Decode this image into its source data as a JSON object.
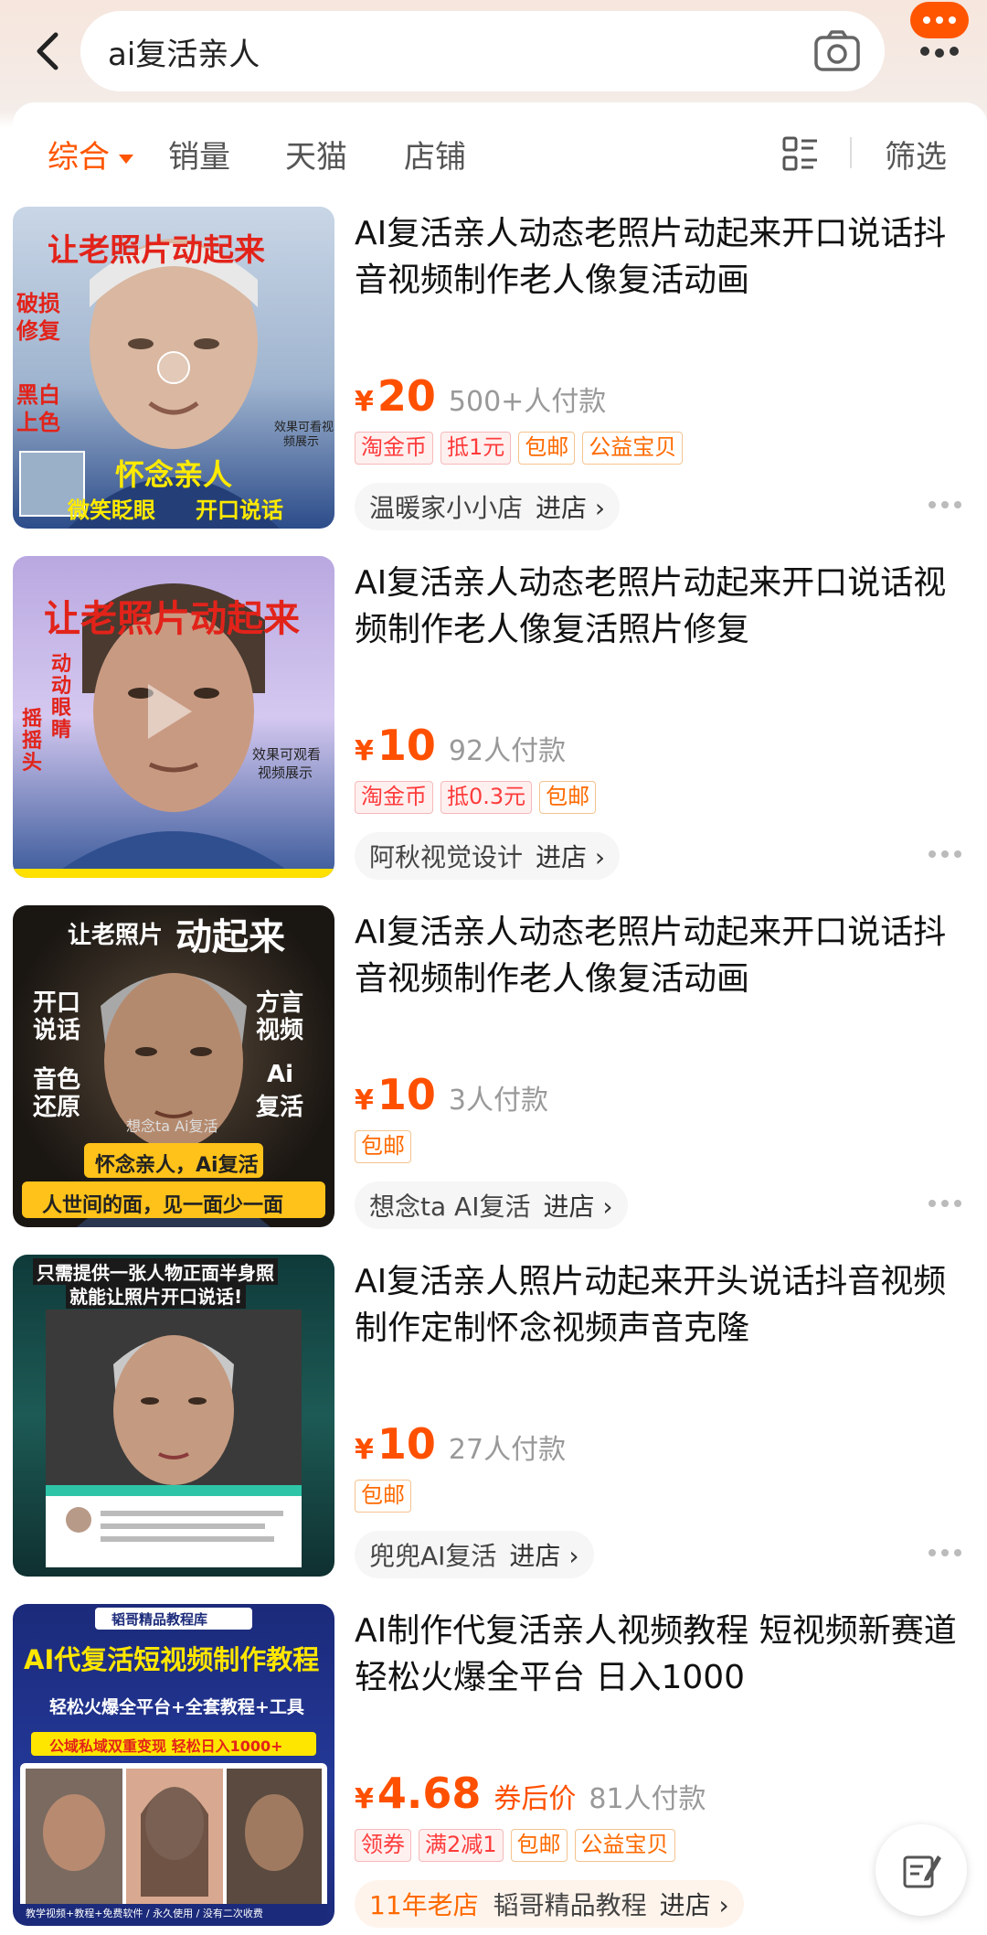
{
  "search": {
    "query": "ai复活亲人"
  },
  "filters": {
    "tabs": [
      {
        "label": "综合"
      },
      {
        "label": "销量"
      },
      {
        "label": "天猫"
      },
      {
        "label": "店铺"
      }
    ],
    "filter_label": "筛选"
  },
  "colors": {
    "accent": "#ff5500",
    "price": "#ff5000"
  },
  "items": [
    {
      "title": "AI复活亲人动态老照片动起来开口说话抖音视频制作老人像复活动画",
      "currency": "¥",
      "price": "20",
      "paid": "500+人付款",
      "tags": [
        "淘金币",
        "抵1元",
        "包邮",
        "公益宝贝"
      ],
      "shop": "温暖家小小店",
      "enter": "进店 ›",
      "thumb_texts": [
        "让老照片动起来",
        "破损",
        "修复",
        "黑白",
        "上色",
        "怀念亲人",
        "微笑眨眼",
        "开口说话",
        "效果可看视",
        "频展示"
      ]
    },
    {
      "title": "AI复活亲人动态老照片动起来开口说话视频制作老人像复活照片修复",
      "currency": "¥",
      "price": "10",
      "paid": "92人付款",
      "tags": [
        "淘金币",
        "抵0.3元",
        "包邮"
      ],
      "shop": "阿秋视觉设计",
      "enter": "进店 ›",
      "thumb_texts": [
        "让老照片动起来",
        "摇",
        "摇",
        "头",
        "动",
        "动",
        "眼",
        "睛",
        "效果可观看",
        "视频展示"
      ]
    },
    {
      "title": "AI复活亲人动态老照片动起来开口说话抖音视频制作老人像复活动画",
      "currency": "¥",
      "price": "10",
      "paid": "3人付款",
      "tags": [
        "包邮"
      ],
      "shop": "想念ta AI复活",
      "enter": "进店 ›",
      "thumb_texts": [
        "让老照片",
        "动起来",
        "开口",
        "说话",
        "方言",
        "视频",
        "音色",
        "还原",
        "Ai",
        "复活",
        "想念ta Ai复活",
        "怀念亲人，Ai复活",
        "人世间的面，见一面少一面"
      ]
    },
    {
      "title": "AI复活亲人照片动起来开头说话抖音视频制作定制怀念视频声音克隆",
      "currency": "¥",
      "price": "10",
      "paid": "27人付款",
      "tags": [
        "包邮"
      ],
      "shop": "兜兜AI复活",
      "enter": "进店 ›",
      "thumb_texts": [
        "只需提供一张人物正面半身照",
        "就能让照片开口说话!"
      ]
    },
    {
      "title": "AI制作代复活亲人视频教程 短视频新赛道轻松火爆全平台 日入1000",
      "currency": "¥",
      "price": "4.68",
      "price_note": "券后价",
      "paid": "81人付款",
      "tags": [
        "领券",
        "满2减1",
        "包邮",
        "公益宝贝"
      ],
      "shop_age": "11年老店",
      "shop": "韬哥精品教程",
      "enter": "进店 ›",
      "thumb_texts": [
        "韬哥精品教程库",
        "AI代复活短视频制作教程",
        "轻松火爆全平台+全套教程+工具",
        "公域私域双重变现 轻松日入1000+",
        "教学视频+教程+免费软件 / 永久使用 / 没有二次收费"
      ]
    }
  ]
}
